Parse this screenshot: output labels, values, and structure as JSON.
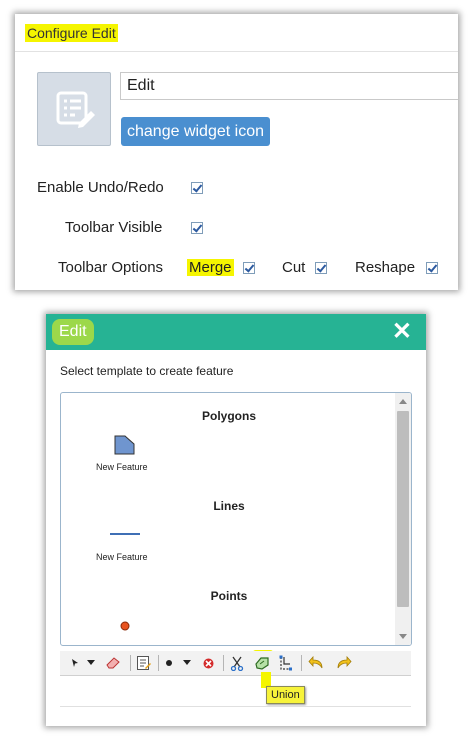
{
  "config_panel": {
    "title": "Configure Edit",
    "widget_name_value": "Edit",
    "change_icon_label": "change widget icon",
    "enable_undo_redo_label": "Enable Undo/Redo",
    "toolbar_visible_label": "Toolbar Visible",
    "toolbar_options_label": "Toolbar Options",
    "merge_label": "Merge",
    "cut_label": "Cut",
    "reshape_label": "Reshape",
    "enable_undo_redo_checked": true,
    "toolbar_visible_checked": true,
    "merge_checked": true,
    "cut_checked": true,
    "reshape_checked": true,
    "highlight_color": "#f5f500"
  },
  "edit_panel": {
    "title": "Edit",
    "close_icon": "close-icon",
    "instruction": "Select template to create feature",
    "header_color": "#26b394",
    "groups": [
      {
        "title": "Polygons",
        "feature_label": "New Feature",
        "icon": "polygon-icon"
      },
      {
        "title": "Lines",
        "feature_label": "New Feature",
        "icon": "line-icon"
      },
      {
        "title": "Points",
        "icon": "point-icon"
      }
    ],
    "toolbar": {
      "tools": [
        "select-icon",
        "eraser-icon",
        "attributes-icon",
        "point-draw-icon",
        "delete-icon",
        "cut-icon",
        "union-icon",
        "reshape-icon",
        "undo-icon",
        "redo-icon"
      ],
      "tooltip": "Union"
    }
  }
}
